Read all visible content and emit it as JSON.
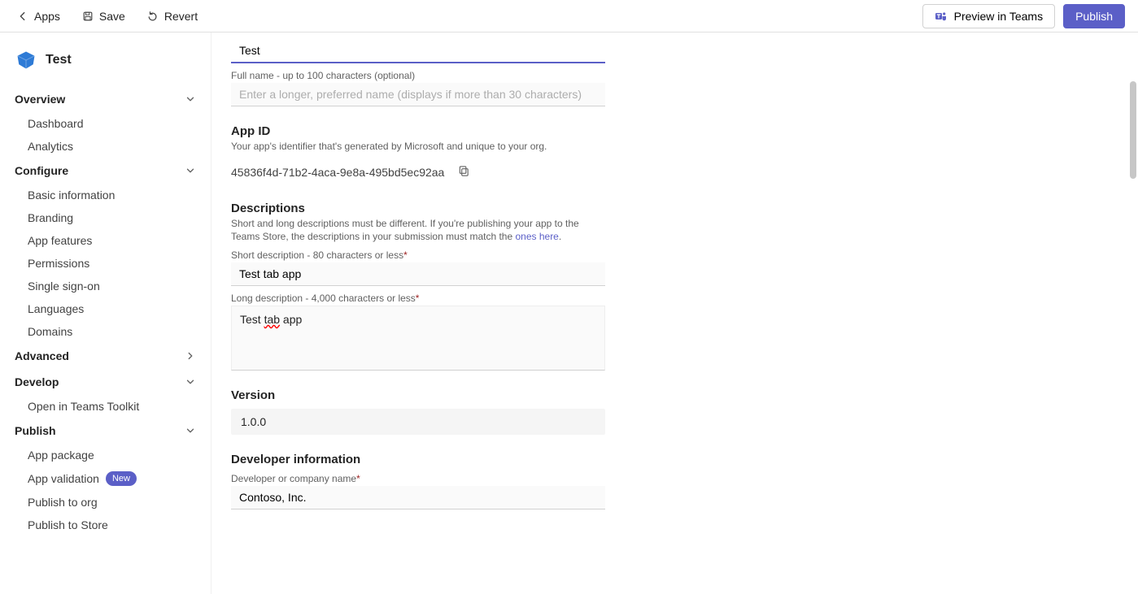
{
  "topbar": {
    "back_label": "Apps",
    "save_label": "Save",
    "revert_label": "Revert",
    "preview_label": "Preview in Teams",
    "publish_label": "Publish"
  },
  "sidebar": {
    "app_name": "Test",
    "sections": {
      "overview": {
        "label": "Overview",
        "items": [
          "Dashboard",
          "Analytics"
        ]
      },
      "configure": {
        "label": "Configure",
        "items": [
          "Basic information",
          "Branding",
          "App features",
          "Permissions",
          "Single sign-on",
          "Languages",
          "Domains"
        ]
      },
      "advanced": {
        "label": "Advanced"
      },
      "develop": {
        "label": "Develop",
        "items": [
          "Open in Teams Toolkit"
        ]
      },
      "publish": {
        "label": "Publish",
        "items": [
          "App package",
          "App validation",
          "Publish to org",
          "Publish to Store"
        ],
        "new_badge": "New"
      }
    }
  },
  "form": {
    "short_name_value": "Test",
    "full_name_label": "Full name - up to 100 characters (optional)",
    "full_name_placeholder": "Enter a longer, preferred name (displays if more than 30 characters)",
    "app_id_title": "App ID",
    "app_id_help": "Your app's identifier that's generated by Microsoft and unique to your org.",
    "app_id_value": "45836f4d-71b2-4aca-9e8a-495bd5ec92aa",
    "descriptions_title": "Descriptions",
    "descriptions_help_a": "Short and long descriptions must be different. If you're publishing your app to the Teams Store, the descriptions in your submission must match the ",
    "descriptions_help_link": "ones here",
    "short_desc_label": "Short description - 80 characters or less",
    "short_desc_value": "Test tab app",
    "long_desc_label": "Long description - 4,000 characters or less",
    "long_desc_value_prefix": "Test ",
    "long_desc_value_mis": "tab",
    "long_desc_value_suffix": " app",
    "version_title": "Version",
    "version_value": "1.0.0",
    "dev_info_title": "Developer information",
    "dev_name_label": "Developer or company name",
    "dev_name_value": "Contoso, Inc."
  }
}
